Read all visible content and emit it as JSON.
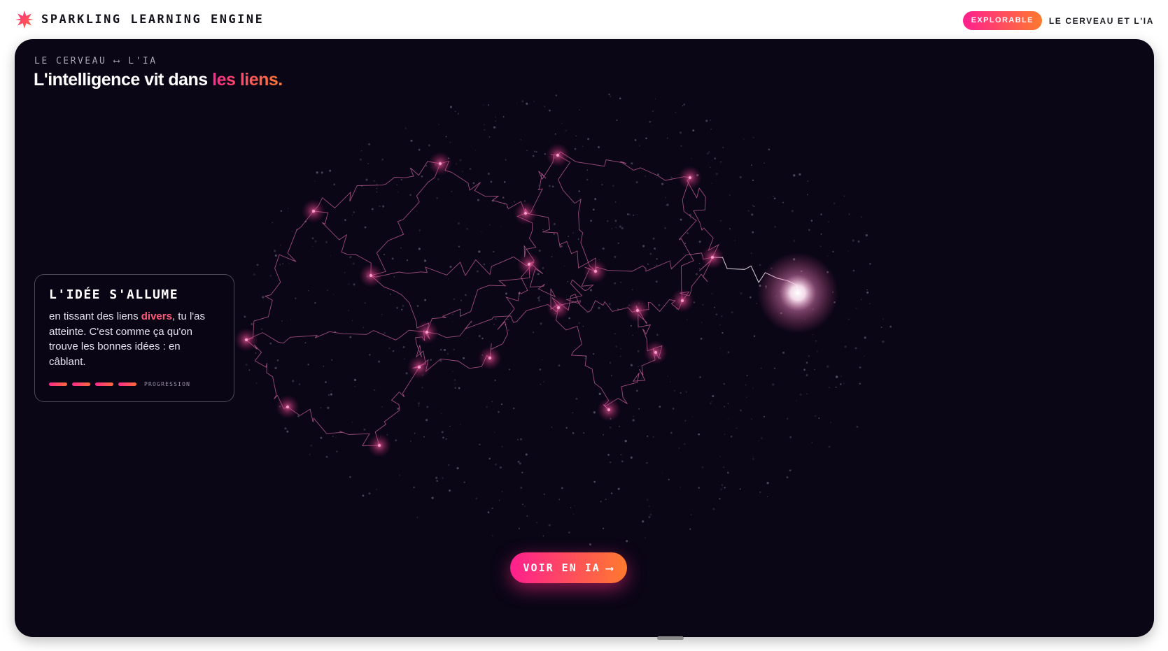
{
  "header": {
    "brand": "SPARKLING LEARNING ENGINE",
    "badge": "EXPLORABLE",
    "subtitle": "LE CERVEAU ET L'IA",
    "brand_icon": "spark-star-icon"
  },
  "stage": {
    "eyebrow": "LE CERVEAU ⟷ L'IA",
    "headline_main": "L'intelligence vit dans ",
    "headline_accent": "les liens."
  },
  "card": {
    "title": "L'IDÉE S'ALLUME",
    "body_before": "en tissant des liens ",
    "body_highlight": "divers",
    "body_after": ", tu l'as atteinte. C'est comme ça qu'on trouve les bonnes idées : en câblant.",
    "progress_label": "PROGRESSION",
    "progress_filled": 4,
    "progress_total": 4
  },
  "cta": {
    "label": "VOIR EN IA",
    "arrow": "⟶"
  },
  "colors": {
    "background": "#0a0616",
    "accent_pink": "#ff1f8e",
    "accent_orange": "#ff7a2e",
    "link_line": "#d86aa8",
    "node_glow": "#ff4fa0"
  }
}
